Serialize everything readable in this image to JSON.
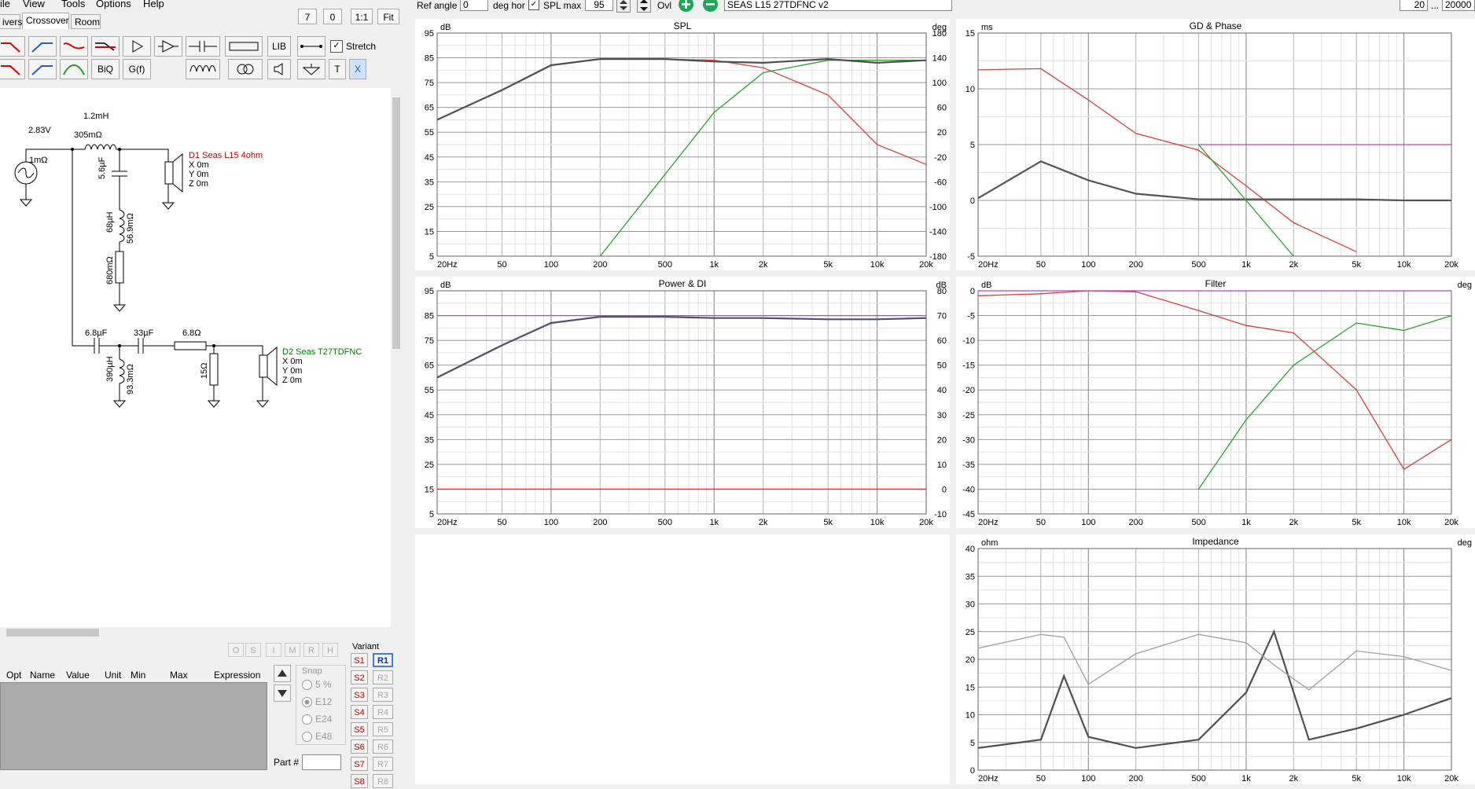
{
  "menu": [
    "ile",
    "View",
    "Tools",
    "Options",
    "Help"
  ],
  "tabs": {
    "drivers": "ivers",
    "crossover": "Crossover",
    "room": "Room"
  },
  "zoom_buttons": [
    "7",
    "0",
    "1:1",
    "Fit"
  ],
  "toolbar": {
    "lib": "LIB",
    "biq": "BiQ",
    "gf": "G(f)",
    "t": "T",
    "x": "X",
    "stretch": "Stretch",
    "stretch_checked": true
  },
  "schematic": {
    "source_voltage": "2.83V",
    "source_res": "1mΩ",
    "l1": "1.2mH",
    "l1_r": "305mΩ",
    "c1": "5.6µF",
    "l2": "68µH",
    "l2_r": "56.9mΩ",
    "r1": "680mΩ",
    "c2": "6.8µF",
    "c3": "33µF",
    "r2": "6.8Ω",
    "l3": "390µH",
    "l3_r": "93.3mΩ",
    "r3": "15Ω",
    "d1": {
      "name": "D1 Seas L15 4ohm",
      "x": "X 0m",
      "y": "Y 0m",
      "z": "Z 0m",
      "color": "#c00000"
    },
    "d2": {
      "name": "D2 Seas T27TDFNC",
      "x": "X 0m",
      "y": "Y 0m",
      "z": "Z 0m",
      "color": "#008000"
    }
  },
  "param_buttons": [
    "O",
    "S",
    "I",
    "M",
    "R",
    "H"
  ],
  "param_columns": [
    "Opt",
    "Name",
    "Value",
    "Unit",
    "Min",
    "Max",
    "Expression"
  ],
  "snap": {
    "label": "Snap",
    "options": [
      "5 %",
      "E12",
      "E24",
      "E48"
    ],
    "selected": "E12"
  },
  "part_label": "Part #",
  "variant": {
    "label": "Variant",
    "s": [
      "S1",
      "S2",
      "S3",
      "S4",
      "S5",
      "S6",
      "S7",
      "S8"
    ],
    "r": [
      "R1",
      "R2",
      "R3",
      "R4",
      "R5",
      "R6",
      "R7",
      "R8"
    ],
    "selected": "R1"
  },
  "topbar": {
    "ref_angle_label": "Ref angle",
    "ref_angle": "0",
    "deg_hor": "deg hor",
    "spl_max_label": "SPL max",
    "spl_max": "95",
    "spl_max_checked": true,
    "ovl": "Ovl",
    "project": "SEAS L15 27TDFNC v2",
    "f_min": "20",
    "f_sep": "...",
    "f_max": "20000"
  },
  "panels": {
    "spl": {
      "title": "SPL",
      "left_unit": "dB",
      "right_unit": "deg",
      "y_left": [
        "95",
        "85",
        "75",
        "65",
        "55",
        "45",
        "35",
        "25",
        "15",
        "5"
      ],
      "y_right": [
        "180",
        "140",
        "100",
        "60",
        "20",
        "-20",
        "-60",
        "-100",
        "-140",
        "-180"
      ]
    },
    "power": {
      "title": "Power & DI",
      "left_unit": "dB",
      "right_unit": "dB",
      "y_left": [
        "95",
        "85",
        "75",
        "65",
        "55",
        "45",
        "35",
        "25",
        "15",
        "5"
      ],
      "y_right": [
        "80",
        "70",
        "60",
        "50",
        "40",
        "30",
        "20",
        "10",
        "0",
        "-10"
      ]
    },
    "gd": {
      "title": "GD & Phase",
      "left_unit": "ms",
      "y_left": [
        "15",
        "10",
        "5",
        "0",
        "-5"
      ]
    },
    "filter": {
      "title": "Filter",
      "left_unit": "dB",
      "right_unit": "deg",
      "y_left": [
        "0",
        "-5",
        "-10",
        "-15",
        "-20",
        "-25",
        "-30",
        "-35",
        "-40",
        "-45"
      ]
    },
    "imp": {
      "title": "Impedance",
      "left_unit": "ohm",
      "right_unit": "deg",
      "y_left": [
        "40",
        "35",
        "30",
        "25",
        "20",
        "15",
        "10",
        "5",
        "0"
      ]
    }
  },
  "x_ticks": [
    "20Hz",
    "50",
    "100",
    "200",
    "500",
    "1k",
    "2k",
    "5k",
    "10k",
    "20k"
  ],
  "chart_data": [
    {
      "type": "line",
      "title": "SPL",
      "x": [
        20,
        50,
        100,
        200,
        500,
        1000,
        2000,
        5000,
        10000,
        20000
      ],
      "series": [
        {
          "values": [
            60,
            72,
            82,
            84.5,
            84.5,
            84,
            81,
            70,
            50,
            42
          ],
          "color": "#d84040"
        },
        {
          "values": [
            null,
            null,
            null,
            5,
            38,
            63,
            79,
            84,
            84,
            84
          ],
          "color": "#2ca02c"
        },
        {
          "values": [
            60,
            72,
            82,
            84.5,
            84.5,
            83.5,
            83,
            84.5,
            83,
            84
          ],
          "color": "#505050"
        }
      ],
      "ylim": [
        5,
        95
      ]
    },
    {
      "type": "line",
      "title": "Power & DI",
      "x": [
        20,
        50,
        100,
        200,
        500,
        1000,
        2000,
        5000,
        10000,
        20000
      ],
      "series": [
        {
          "values": [
            60,
            73,
            82,
            84.5,
            84.5,
            84,
            84,
            83.5,
            83.5,
            84
          ],
          "color": "#505070"
        },
        {
          "values": [
            85,
            85,
            85,
            85,
            85,
            85,
            85,
            85,
            85,
            85
          ],
          "color": "#c040c0"
        },
        {
          "values": [
            15,
            15,
            15,
            15,
            15,
            15,
            15,
            15,
            15,
            15
          ],
          "color": "#e03030"
        }
      ],
      "ylim": [
        5,
        95
      ]
    },
    {
      "type": "line",
      "title": "GD & Phase",
      "x": [
        20,
        50,
        100,
        200,
        500,
        1000,
        2000,
        5000,
        10000,
        20000
      ],
      "series": [
        {
          "values": [
            11.7,
            11.8,
            9,
            6,
            4.5,
            1.3,
            -2,
            -4.6,
            null,
            null
          ],
          "color": "#d84040"
        },
        {
          "values": [
            0.2,
            3.5,
            1.8,
            0.6,
            0.1,
            0.1,
            0.1,
            0.1,
            0,
            0
          ],
          "color": "#555555"
        },
        {
          "values": [
            null,
            null,
            null,
            null,
            5,
            5,
            5,
            5,
            5,
            5
          ],
          "color": "#c040c0"
        },
        {
          "values": [
            null,
            null,
            null,
            null,
            5,
            0,
            -5,
            null,
            null,
            null
          ],
          "color": "#2ca02c"
        }
      ],
      "ylim": [
        -5,
        15
      ]
    },
    {
      "type": "line",
      "title": "Filter",
      "x": [
        20,
        50,
        100,
        200,
        500,
        1000,
        2000,
        5000,
        10000,
        20000
      ],
      "series": [
        {
          "values": [
            -1,
            -0.6,
            0,
            -0.2,
            -4,
            -7,
            -8.5,
            -20,
            -36,
            -30
          ],
          "color": "#d84040"
        },
        {
          "values": [
            null,
            null,
            null,
            null,
            -40,
            -26,
            -15,
            -6.5,
            -8,
            -5
          ],
          "color": "#2ca02c"
        },
        {
          "values": [
            0,
            0,
            0,
            0,
            0,
            0,
            0,
            0,
            0,
            0
          ],
          "color": "#c040c0"
        }
      ],
      "ylim": [
        -45,
        0
      ]
    },
    {
      "type": "line",
      "title": "Impedance",
      "x": [
        20,
        50,
        70,
        100,
        200,
        500,
        1000,
        1500,
        2500,
        5000,
        10000,
        20000
      ],
      "series": [
        {
          "values": [
            4,
            5.5,
            17,
            6,
            4,
            5.5,
            14,
            25,
            5.5,
            7.5,
            10,
            13
          ],
          "color": "#505050"
        },
        {
          "values": [
            22,
            24.5,
            24,
            15.5,
            21,
            24.5,
            23,
            19,
            14.5,
            21.5,
            20.5,
            18
          ],
          "color": "#a0a0a0"
        }
      ],
      "ylim": [
        0,
        40
      ]
    }
  ]
}
